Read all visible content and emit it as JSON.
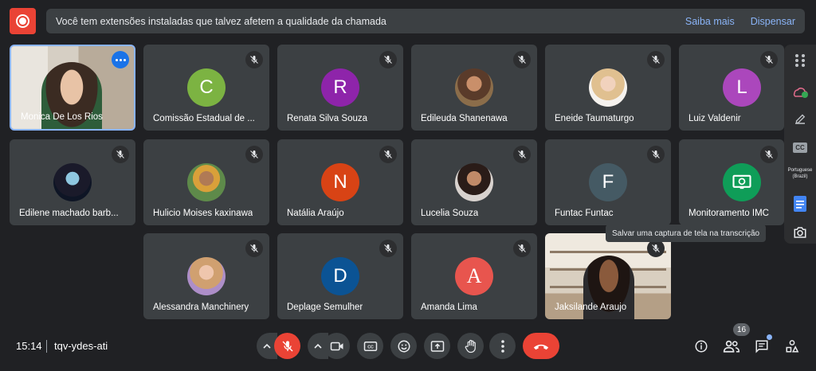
{
  "banner": {
    "message": "Você tem extensões instaladas que talvez afetem a qualidade da chamada",
    "learn_more": "Saiba mais",
    "dismiss": "Dispensar"
  },
  "participants": [
    {
      "name": "Monica De Los Rios"
    },
    {
      "name": "Comissão Estadual de ...",
      "initial": "C",
      "color": "#7cb342"
    },
    {
      "name": "Renata Silva Souza",
      "initial": "R",
      "color": "#8e24aa"
    },
    {
      "name": "Edileuda Shanenawa"
    },
    {
      "name": "Eneide Taumaturgo"
    },
    {
      "name": "Luiz Valdenir",
      "initial": "L",
      "color": "#ab47bc"
    },
    {
      "name": "Edilene machado barb..."
    },
    {
      "name": "Hulicio Moises kaxinawa"
    },
    {
      "name": "Natália Araújo",
      "initial": "N",
      "color": "#d84315"
    },
    {
      "name": "Lucelia Souza"
    },
    {
      "name": "Funtac Funtac",
      "initial": "F",
      "color": "#455a64"
    },
    {
      "name": "Monitoramento IMC"
    },
    {
      "name": "Alessandra Manchinery"
    },
    {
      "name": "Deplage Semulher",
      "initial": "D",
      "color": "#0b5394"
    },
    {
      "name": "Amanda Lima",
      "initial": "A",
      "color": "#e8554e"
    },
    {
      "name": "Jaksilande Araujo"
    }
  ],
  "side_rail": {
    "language_line1": "Portuguese",
    "language_line2": "(Brazil)",
    "tooltip": "Salvar uma captura de tela na transcrição"
  },
  "bottom_bar": {
    "time": "15:14",
    "meeting_code": "tqv-ydes-ati",
    "participant_count": "16"
  },
  "colors": {
    "background": "#202124",
    "tile": "#3c4043",
    "accent_red": "#ea4335",
    "accent_blue": "#8ab4f8"
  }
}
